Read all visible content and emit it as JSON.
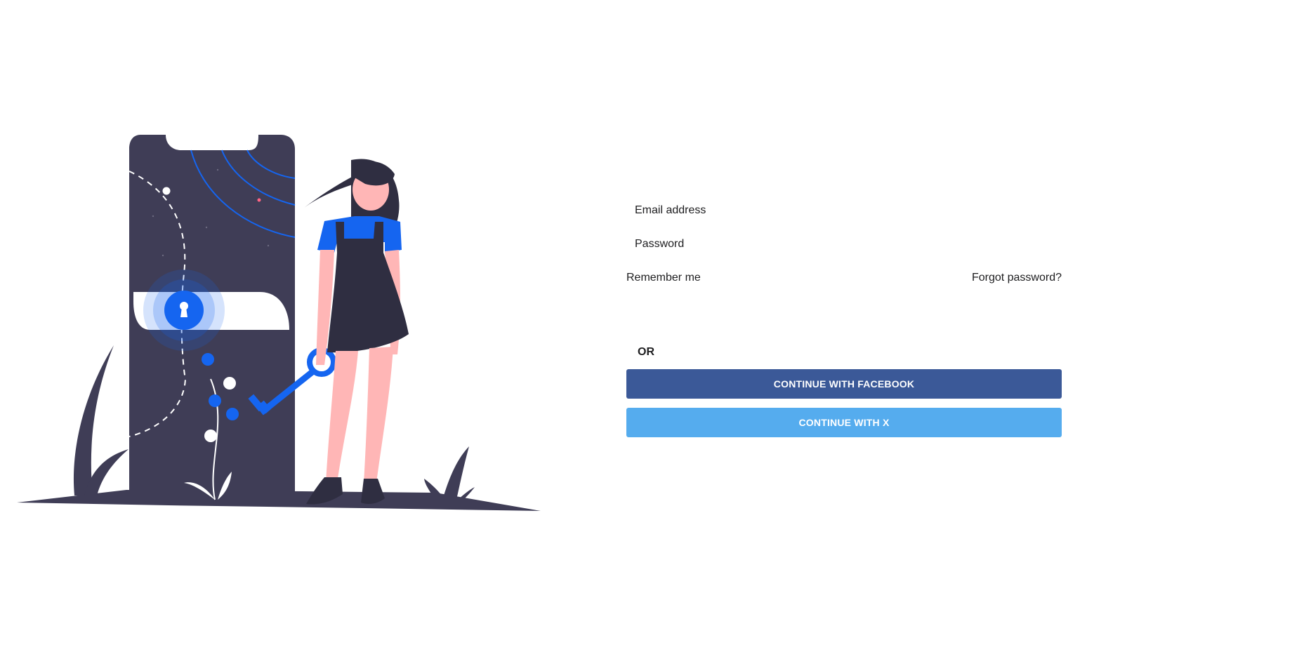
{
  "form": {
    "email_label": "Email address",
    "password_label": "Password",
    "remember_label": "Remember me",
    "forgot_label": "Forgot password?",
    "or_label": "OR"
  },
  "social": {
    "facebook_label": "CONTINUE WITH FACEBOOK",
    "x_label": "CONTINUE WITH X"
  },
  "colors": {
    "facebook": "#3b5998",
    "x": "#55acee",
    "illustration_dark": "#3f3d56",
    "illustration_accent": "#1565f0",
    "skin": "#ffb6b6"
  },
  "illustration": {
    "description_icon": "phone-unlock-icon"
  }
}
